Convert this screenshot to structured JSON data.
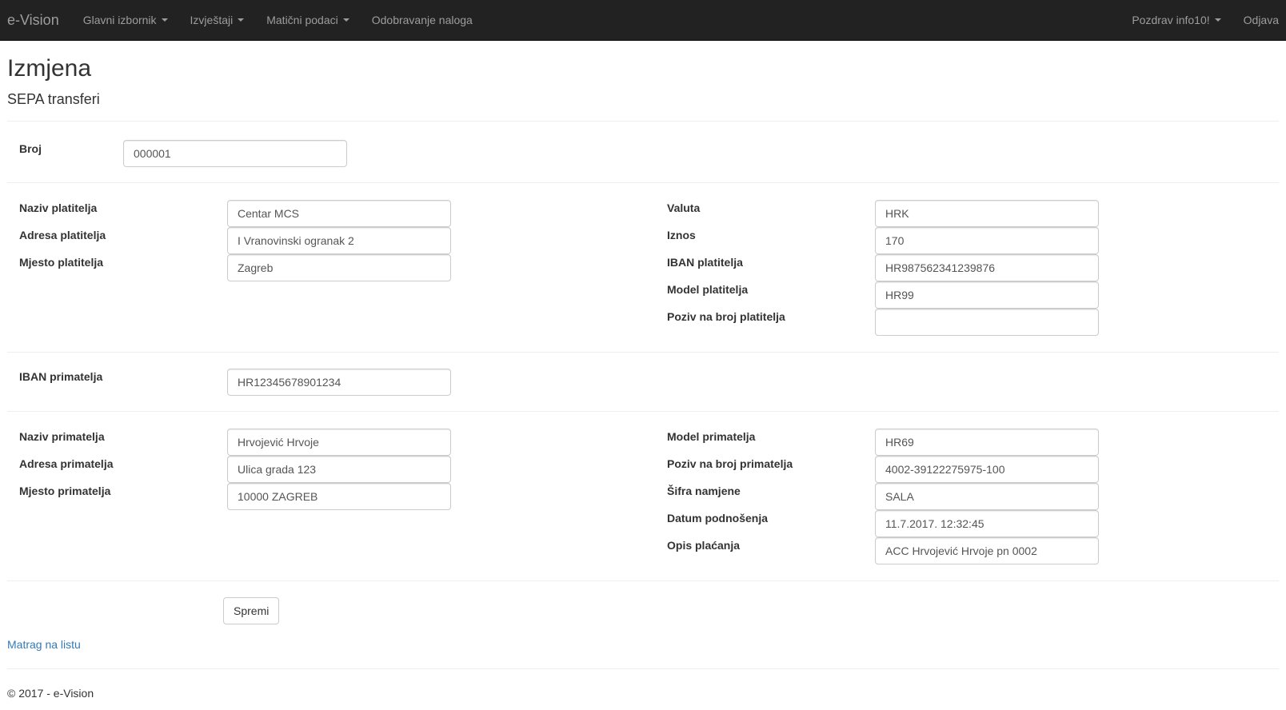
{
  "navbar": {
    "brand": "e-Vision",
    "menu": [
      {
        "label": "Glavni izbornik",
        "dropdown": true
      },
      {
        "label": "Izvještaji",
        "dropdown": true
      },
      {
        "label": "Matični podaci",
        "dropdown": true
      },
      {
        "label": "Odobravanje naloga",
        "dropdown": false
      }
    ],
    "user_greeting": "Pozdrav info10!",
    "logout": "Odjava"
  },
  "page": {
    "title": "Izmjena",
    "subtitle": "SEPA transferi"
  },
  "form": {
    "broj": {
      "label": "Broj",
      "value": "000001"
    },
    "payer": [
      {
        "label": "Naziv platitelja",
        "value": "Centar MCS"
      },
      {
        "label": "Adresa platitelja",
        "value": "I Vranovinski ogranak 2"
      },
      {
        "label": "Mjesto platitelja",
        "value": "Zagreb"
      }
    ],
    "payer_right": [
      {
        "label": "Valuta",
        "value": "HRK"
      },
      {
        "label": "Iznos",
        "value": "170"
      },
      {
        "label": "IBAN platitelja",
        "value": "HR987562341239876"
      },
      {
        "label": "Model platitelja",
        "value": "HR99"
      },
      {
        "label": "Poziv na broj platitelja",
        "value": ""
      }
    ],
    "iban_primatelja": {
      "label": "IBAN primatelja",
      "value": "HR12345678901234"
    },
    "recipient": [
      {
        "label": "Naziv primatelja",
        "value": "Hrvojević Hrvoje"
      },
      {
        "label": "Adresa primatelja",
        "value": "Ulica grada 123"
      },
      {
        "label": "Mjesto primatelja",
        "value": "10000 ZAGREB"
      }
    ],
    "recipient_right": [
      {
        "label": "Model primatelja",
        "value": "HR69"
      },
      {
        "label": "Poziv na broj primatelja",
        "value": "4002-39122275975-100"
      },
      {
        "label": "Šifra namjene",
        "value": "SALA"
      },
      {
        "label": "Datum podnošenja",
        "value": "11.7.2017. 12:32:45"
      },
      {
        "label": "Opis plaćanja",
        "value": "ACC Hrvojević Hrvoje pn 0002"
      }
    ],
    "save_button": "Spremi"
  },
  "back_link": "Matrag na listu",
  "footer": "© 2017 - e-Vision"
}
